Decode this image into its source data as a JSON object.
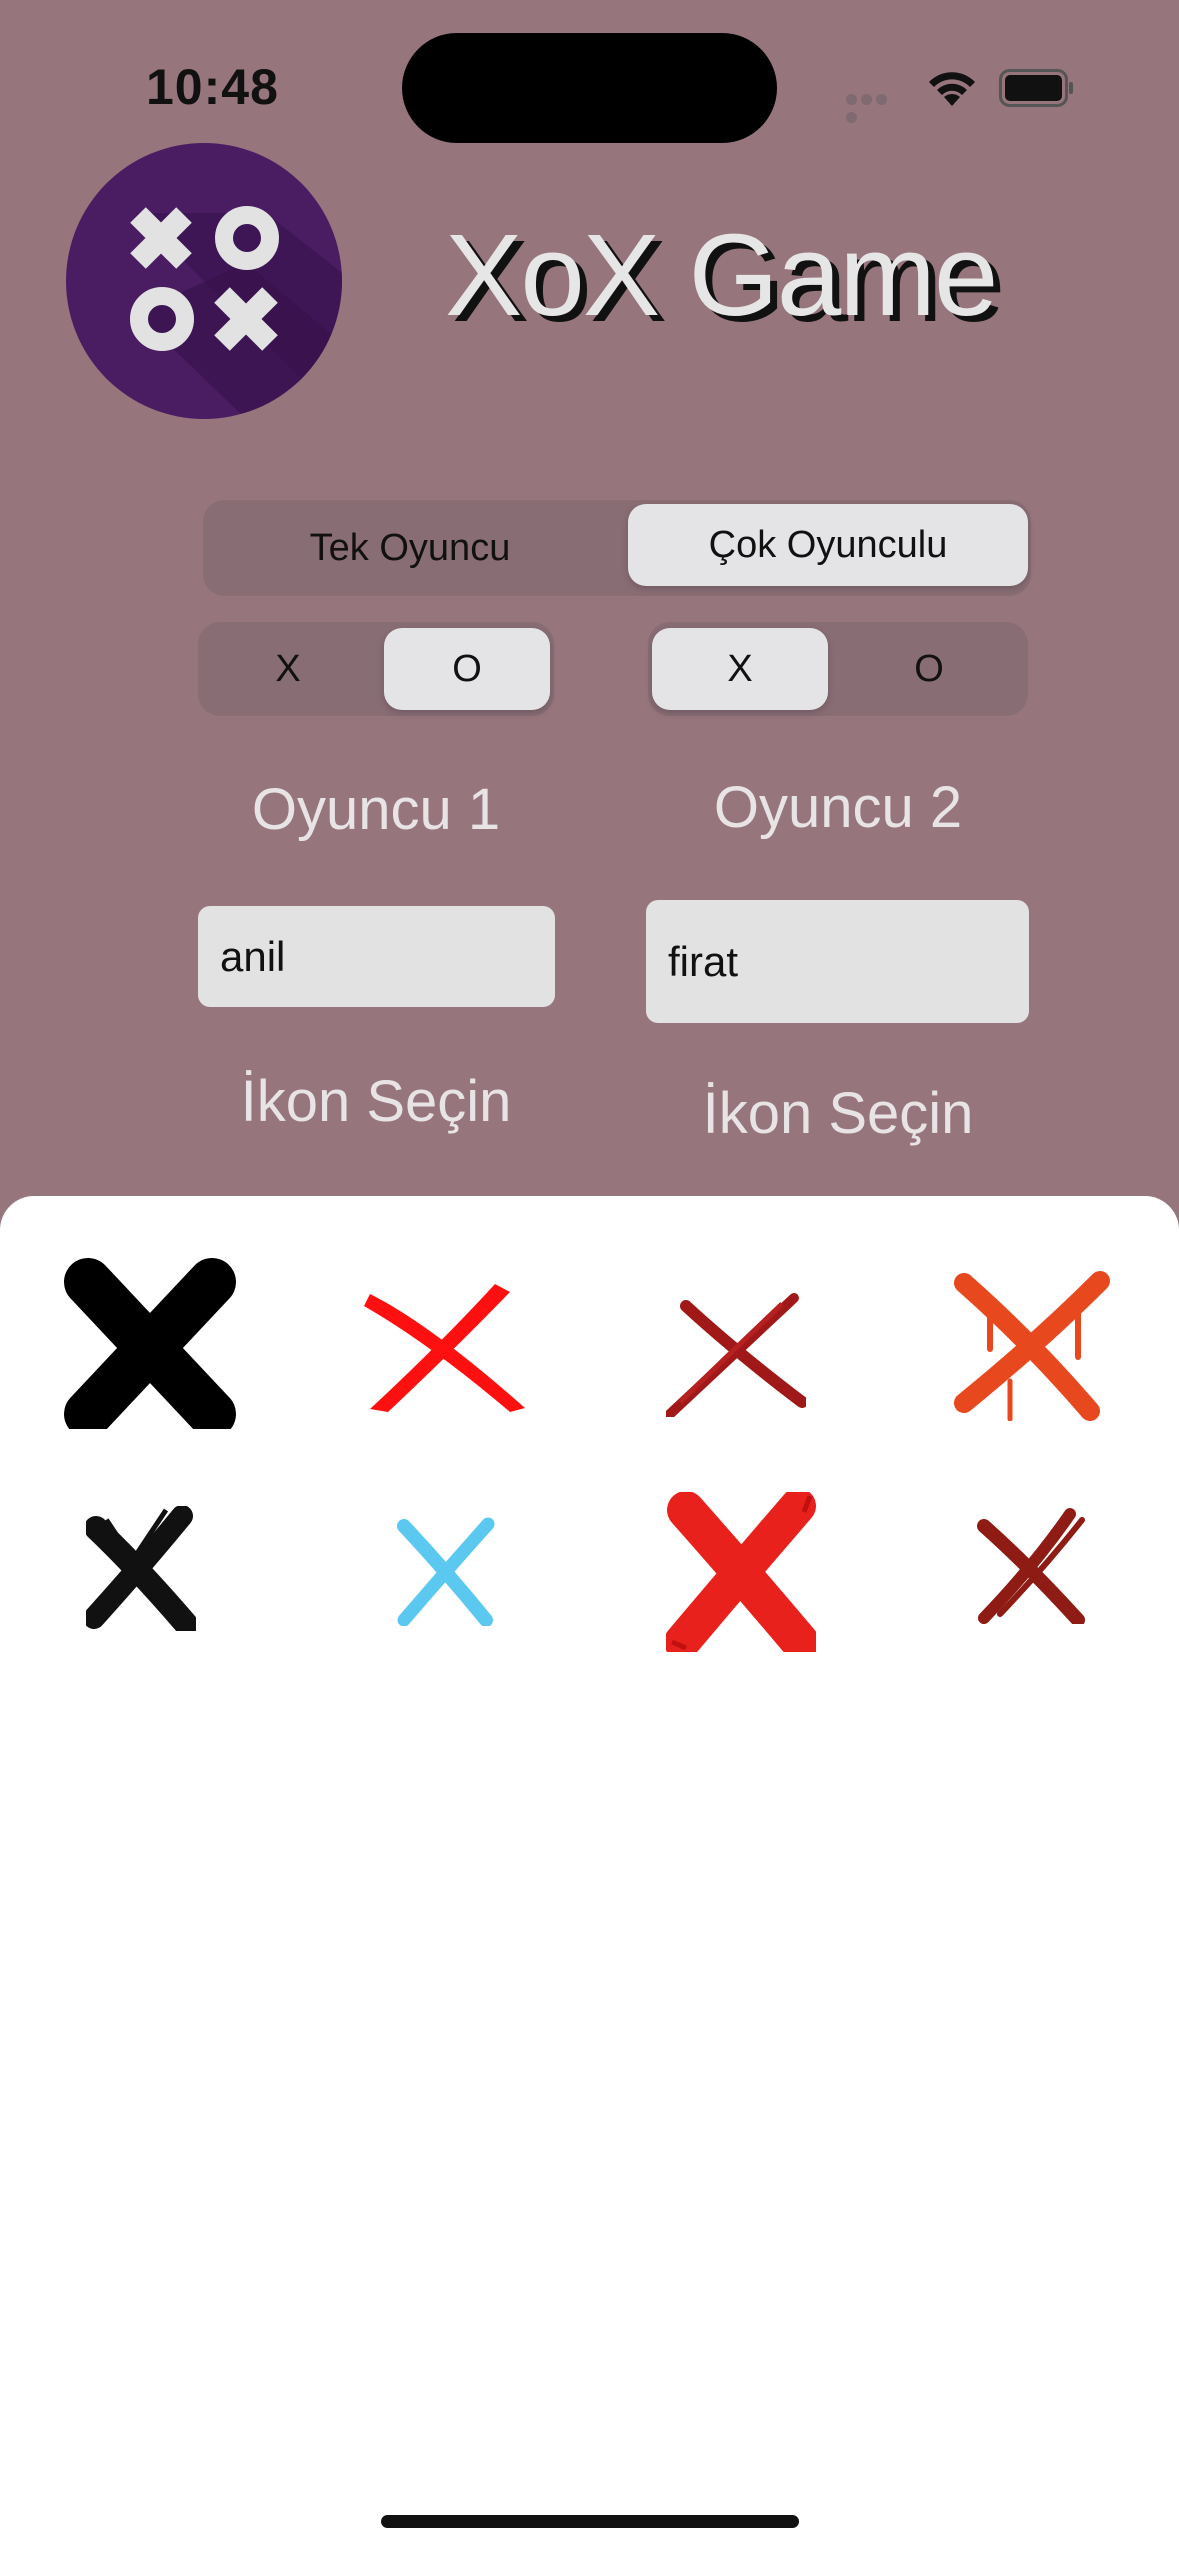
{
  "status_bar": {
    "time": "10:48"
  },
  "app": {
    "title": "XoX Game"
  },
  "mode_selector": {
    "options": [
      "Tek Oyuncu",
      "Çok Oyunculu"
    ],
    "selected": "Çok Oyunculu"
  },
  "player1": {
    "label": "Oyuncu 1",
    "symbol_options": [
      "X",
      "O"
    ],
    "selected_symbol": "O",
    "name_value": "anil",
    "icon_prompt": "İkon Seçin"
  },
  "player2": {
    "label": "Oyuncu 2",
    "symbol_options": [
      "X",
      "O"
    ],
    "selected_symbol": "X",
    "name_value": "firat",
    "icon_prompt": "İkon Seçin"
  },
  "icon_picker": {
    "icons": [
      {
        "name": "bold-black-x-icon",
        "color": "#000000"
      },
      {
        "name": "red-brush-x-icon",
        "color": "#FF1010"
      },
      {
        "name": "dark-red-scratch-x-icon",
        "color": "#A01818"
      },
      {
        "name": "orange-drip-x-icon",
        "color": "#E8481E"
      },
      {
        "name": "black-brush-x-icon",
        "color": "#111111"
      },
      {
        "name": "blue-x-icon",
        "color": "#5BC8F0"
      },
      {
        "name": "red-paint-x-icon",
        "color": "#E8211C"
      },
      {
        "name": "maroon-x-icon",
        "color": "#8E1B14"
      }
    ]
  }
}
